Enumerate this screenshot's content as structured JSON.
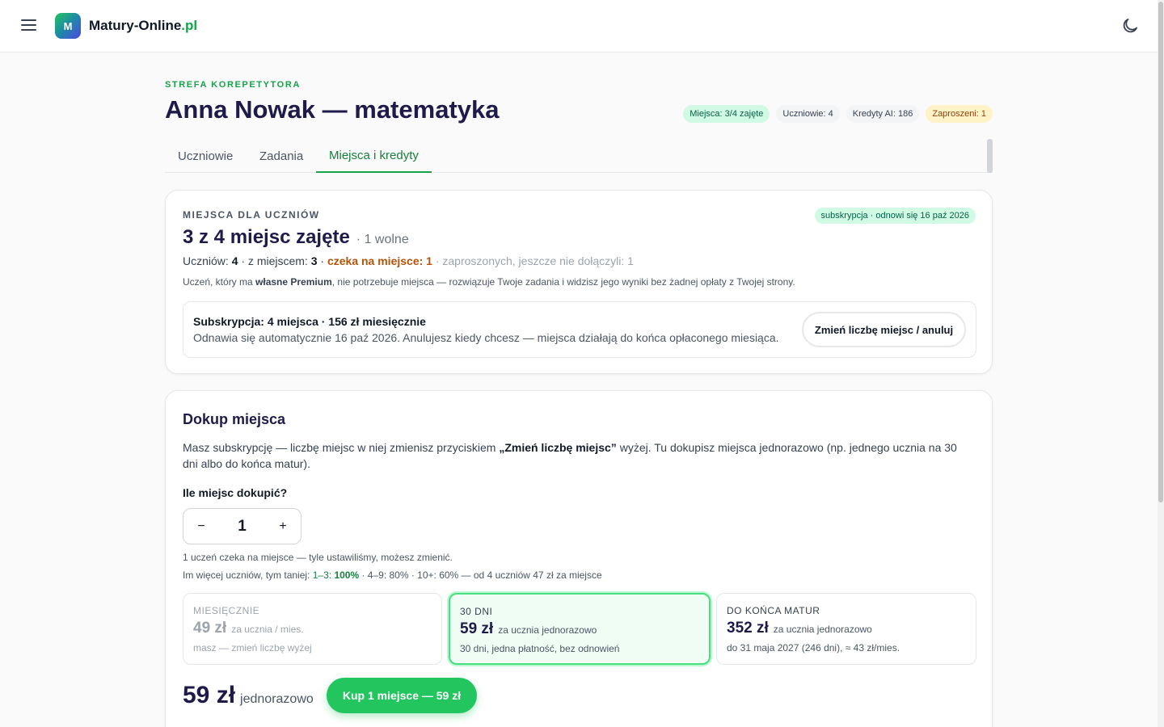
{
  "header": {
    "logo_letter": "M",
    "brand_name": "Matury-Online",
    "brand_tld": ".pl",
    "menu_icon": "hamburger-menu-icon",
    "theme_icon": "moon-icon"
  },
  "page": {
    "eyebrow": "STREFA KOREPETYTORA",
    "title": "Anna Nowak — matematyka",
    "chips": [
      {
        "label": "Miejsca: 3/4 zajęte",
        "tone": "green"
      },
      {
        "label": "Uczniowie: 4",
        "tone": "gray"
      },
      {
        "label": "Kredyty AI: 186",
        "tone": "gray"
      },
      {
        "label": "Zaproszeni: 1",
        "tone": "yellow"
      }
    ],
    "tabs": [
      {
        "label": "Uczniowie",
        "active": false
      },
      {
        "label": "Zadania",
        "active": false
      },
      {
        "label": "Miejsca i kredyty",
        "active": true
      }
    ]
  },
  "seats_card": {
    "label": "MIEJSCA DLA UCZNIÓW",
    "subscription_chip": "subskrypcja · odnowi się 16 paź 2026",
    "headline": "3 z 4 miejsc zajęte",
    "free": "· 1 wolne",
    "stats": {
      "students_label": "Uczniów: ",
      "students_value": "4",
      "with_seat_label": " · z miejscem: ",
      "with_seat_value": "3",
      "sep": " · ",
      "waiting": "czeka na miejsce: 1",
      "invited": " · zaproszonych, jeszcze nie dołączyli: 1"
    },
    "note_pre": "Uczeń, który ma ",
    "note_bold": "własne Premium",
    "note_post": ", nie potrzebuje miejsca — rozwiązuje Twoje zadania i widzisz jego wyniki bez żadnej opłaty z Twojej strony.",
    "subscription": {
      "title": "Subskrypcja: 4 miejsca · 156 zł miesięcznie",
      "desc": "Odnawia się automatycznie 16 paź 2026. Anulujesz kiedy chcesz — miejsca działają do końca opłaconego miesiąca.",
      "button": "Zmień liczbę miejsc / anuluj"
    }
  },
  "buy_card": {
    "title": "Dokup miejsca",
    "desc_pre": "Masz subskrypcję — liczbę miejsc w niej zmienisz przyciskiem ",
    "desc_bold": "„Zmień liczbę miejsc”",
    "desc_post": " wyżej. Tu dokupisz miejsca jednorazowo (np. jednego ucznia na 30 dni albo do końca matur).",
    "qty_label": "Ile miejsc dokupić?",
    "qty_minus": "−",
    "qty_value": "1",
    "qty_plus": "+",
    "hint1": "1 uczeń czeka na miejsce — tyle ustawiliśmy, możesz zmienić.",
    "hint2_pre": "Im więcej uczniów, tym taniej: ",
    "hint2_tier1": "1–3: ",
    "hint2_tier1_value": "100%",
    "hint2_post": " · 4–9: 80% · 10+: 60% — od 4 uczniów 47 zł za miejsce",
    "plans": [
      {
        "head": "MIESIĘCZNIE",
        "amount": "49 zł",
        "unit": "za ucznia / mies.",
        "note": "masz — zmień liczbę wyżej",
        "state": "disabled"
      },
      {
        "head": "30 DNI",
        "amount": "59 zł",
        "unit": "za ucznia jednorazowo",
        "note": "30 dni, jedna płatność, bez odnowień",
        "state": "selected"
      },
      {
        "head": "DO KOŃCA MATUR",
        "amount": "352 zł",
        "unit": "za ucznia jednorazowo",
        "note": "do 31 maja 2027 (246 dni), ≈ 43 zł/mies.",
        "state": "normal"
      }
    ],
    "total_amount": "59 zł",
    "total_suffix": "jednorazowo",
    "buy_button": "Kup 1 miejsce — 59 zł"
  }
}
